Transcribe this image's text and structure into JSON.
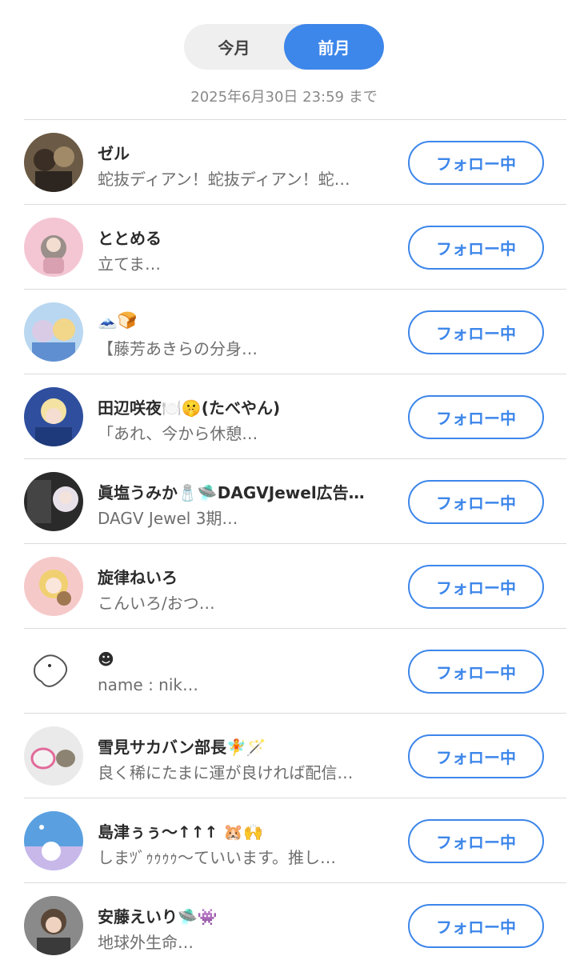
{
  "tabs": {
    "current_month": "今月",
    "previous_month": "前月",
    "active": "previous_month"
  },
  "deadline": "2025年6月30日 23:59 まで",
  "follow_label": "フォロー中",
  "users": [
    {
      "name": "ゼル",
      "bio": "蛇抜ディアン！蛇抜ディアン！蛇…",
      "avatar_icon": "avatar-illustration-icon",
      "avatar_color": "#6b5a45"
    },
    {
      "name": "ととめる",
      "bio": "立てま…",
      "avatar_icon": "avatar-illustration-icon",
      "avatar_color": "#f4c6d3"
    },
    {
      "name": "🗻🍞",
      "bio": "【藤芳あきらの分身…",
      "avatar_icon": "avatar-illustration-icon",
      "avatar_color": "#b9d7f0"
    },
    {
      "name": "田辺咲夜🍽️🤫(たべやん)",
      "bio": "「あれ、今から休憩…",
      "avatar_icon": "avatar-illustration-icon",
      "avatar_color": "#2f4f9e"
    },
    {
      "name": "眞塩うみか🧂🛸DAGVJewel広告…",
      "bio": "DAGV Jewel 3期…",
      "avatar_icon": "avatar-illustration-icon",
      "avatar_color": "#2a2a2a"
    },
    {
      "name": "旋律ねいろ",
      "bio": "こんいろ/おつ…",
      "avatar_icon": "avatar-illustration-icon",
      "avatar_color": "#f6c9c9"
    },
    {
      "name": "☻",
      "bio": "name : nik…",
      "avatar_icon": "avatar-sketch-icon",
      "avatar_color": "#ffffff"
    },
    {
      "name": "雪見サカバン部長🧚🪄",
      "bio": "良く稀にたまに運が良ければ配信…",
      "avatar_icon": "avatar-illustration-icon",
      "avatar_color": "#eaeaea"
    },
    {
      "name": "島津ぅぅ〜↑↑↑ 🐹🙌",
      "bio": "しまﾂﾞｩｩｩｩ〜ていいます。推し…",
      "avatar_icon": "avatar-illustration-icon",
      "avatar_color": "#5aa0e0"
    },
    {
      "name": "安藤えいり🛸👾",
      "bio": "地球外生命…",
      "avatar_icon": "avatar-illustration-icon",
      "avatar_color": "#8a8a8a"
    }
  ]
}
